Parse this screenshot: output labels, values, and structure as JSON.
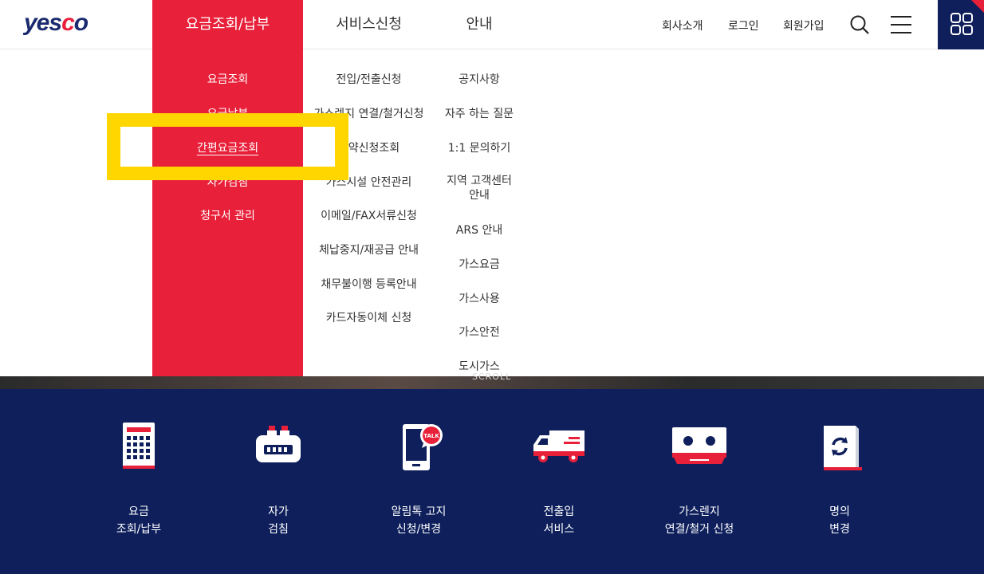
{
  "header": {
    "logo": {
      "main": "yes",
      "accent": "c",
      "rest": "o"
    },
    "gnb": [
      "요금조회/납부",
      "서비스신청",
      "안내"
    ],
    "util": [
      "회사소개",
      "로그인",
      "회원가입"
    ],
    "icons": {
      "search": "search-icon",
      "hamburger": "hamburger-icon",
      "all_menu": "grid-icon"
    }
  },
  "dropdown": {
    "col1": [
      "요금조회",
      "요금납부",
      "간편요금조회",
      "자가검침",
      "청구서 관리"
    ],
    "col2": [
      "전입/전출신청",
      "가스렌지 연결/철거신청",
      "예약신청조회",
      "가스시설 안전관리",
      "이메일/FAX서류신청",
      "체납중지/재공급 안내",
      "채무불이행 등록안내",
      "카드자동이체 신청"
    ],
    "col3": [
      "공지사항",
      "자주 하는 질문",
      "1:1 문의하기",
      "지역 고객센터",
      "안내",
      "ARS 안내",
      "가스요금",
      "가스사용",
      "가스안전",
      "도시가스"
    ]
  },
  "scroll_label": "SCROLL",
  "quick": [
    {
      "line1": "요금",
      "line2": "조회/납부",
      "icon": "calculator-icon"
    },
    {
      "line1": "자가",
      "line2": "검침",
      "icon": "gas-meter-icon"
    },
    {
      "line1": "알림톡 고지",
      "line2": "신청/변경",
      "icon": "talk-phone-icon"
    },
    {
      "line1": "전출입",
      "line2": "서비스",
      "icon": "moving-truck-icon"
    },
    {
      "line1": "가스렌지",
      "line2": "연결/철거 신청",
      "icon": "gas-range-icon"
    },
    {
      "line1": "명의",
      "line2": "변경",
      "icon": "name-change-icon"
    }
  ],
  "colors": {
    "brand_red": "#e8203a",
    "brand_navy": "#0e1f5b",
    "highlight": "#ffd600"
  }
}
